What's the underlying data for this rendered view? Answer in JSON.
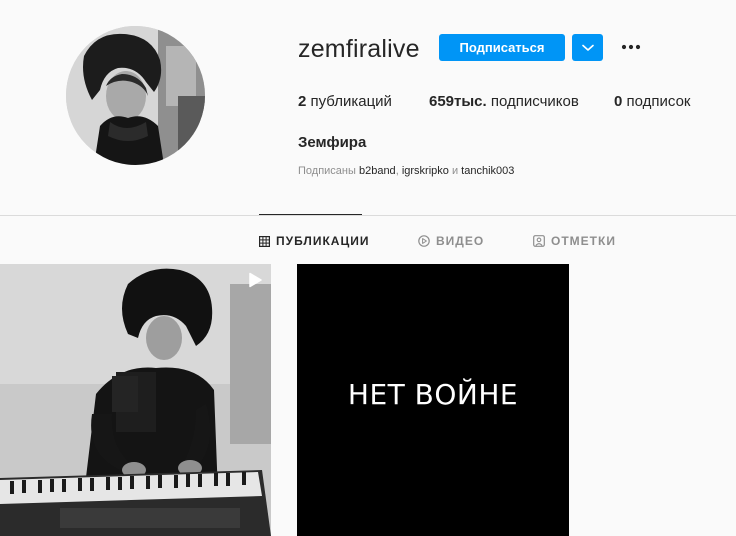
{
  "profile": {
    "username": "zemfiralive",
    "full_name": "Земфира",
    "follow_label": "Подписаться",
    "posts_count": "2",
    "posts_label": "публикаций",
    "followers_count": "659тыс.",
    "followers_label": "подписчиков",
    "following_count": "0",
    "following_label": "подписок",
    "followed_by_prefix": "Подписаны",
    "followed_by": [
      "b2band",
      "igrskripko",
      "tanchik003"
    ],
    "followed_by_sep": ",",
    "followed_by_and": "и"
  },
  "tabs": [
    {
      "label": "ПУБЛИКАЦИИ",
      "icon": "grid-icon",
      "active": true
    },
    {
      "label": "ВИДЕО",
      "icon": "play-circle-icon",
      "active": false
    },
    {
      "label": "ОТМЕТКИ",
      "icon": "tag-user-icon",
      "active": false
    }
  ],
  "posts": [
    {
      "type": "video",
      "icon": "reel-play-icon"
    },
    {
      "type": "image",
      "text": "НЕТ ВОЙНЕ"
    }
  ],
  "colors": {
    "accent": "#0095f6",
    "background": "#fafafa",
    "text": "#262626",
    "muted": "#8e8e8e"
  }
}
